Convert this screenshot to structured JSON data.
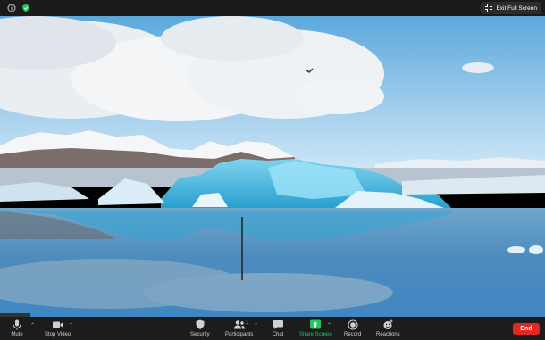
{
  "topbar": {
    "exit_label": "Exit Full Screen"
  },
  "toolbar": {
    "mute": "Mute",
    "stop_video": "Stop Video",
    "security": "Security",
    "participants": "Participants",
    "participants_count": "1",
    "chat": "Chat",
    "share_screen": "Share Screen",
    "record": "Record",
    "reactions": "Reactions",
    "end": "End"
  },
  "colors": {
    "share_green": "#22c55e",
    "end_red": "#e02828"
  }
}
